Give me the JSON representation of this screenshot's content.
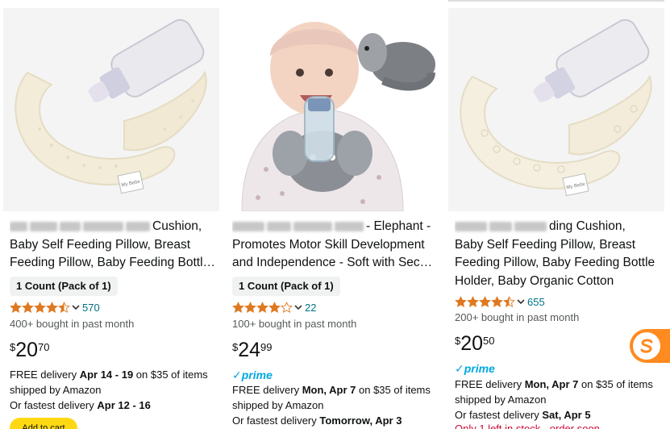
{
  "products": [
    {
      "title_line1_visible": "Cushion,",
      "title_line2": "Baby Self Feeding Pillow, Breast",
      "title_line3": "Feeding Pillow, Baby Feeding Bottl…",
      "title_line4": "",
      "pack": "1 Count (Pack of 1)",
      "rating_stars": 4.5,
      "rating_count": "570",
      "bought": "400+ bought in past month",
      "price_symbol": "$",
      "price_whole": "20",
      "price_fraction": "70",
      "prime": false,
      "delivery": {
        "prefix": "FREE delivery ",
        "date": "Apr 14 - 19",
        "suffix": " on $35 of items"
      },
      "shipped_by": "shipped by Amazon",
      "fastest": {
        "prefix": "Or fastest delivery ",
        "date": "Apr 12 - 16"
      },
      "add_to_cart": "Add to cart",
      "low_stock": ""
    },
    {
      "title_line1_visible": "- Elephant -",
      "title_line2": "Promotes Motor Skill Development",
      "title_line3": "and Independence - Soft with Sec…",
      "title_line4": "",
      "pack": "1 Count (Pack of 1)",
      "rating_stars": 4.0,
      "rating_count": "22",
      "bought": "100+ bought in past month",
      "price_symbol": "$",
      "price_whole": "24",
      "price_fraction": "99",
      "prime": true,
      "prime_label": "prime",
      "delivery": {
        "prefix": "FREE delivery ",
        "date": "Mon, Apr 7",
        "suffix": " on $35 of items"
      },
      "shipped_by": "shipped by Amazon",
      "fastest": {
        "prefix": "Or fastest delivery ",
        "date": "Tomorrow, Apr 3"
      },
      "add_to_cart": "",
      "low_stock": ""
    },
    {
      "title_line1_visible": "ding Cushion,",
      "title_line2": "Baby Self Feeding Pillow, Breast",
      "title_line3": "Feeding Pillow, Baby Feeding Bottle",
      "title_line4": "Holder, Baby Organic Cotton",
      "pack": "",
      "rating_stars": 4.5,
      "rating_count": "655",
      "bought": "200+ bought in past month",
      "price_symbol": "$",
      "price_whole": "20",
      "price_fraction": "50",
      "prime": true,
      "prime_label": "prime",
      "delivery": {
        "prefix": "FREE delivery ",
        "date": "Mon, Apr 7",
        "suffix": " on $35 of items"
      },
      "shipped_by": "shipped by Amazon",
      "fastest": {
        "prefix": "Or fastest delivery ",
        "date": "Sat, Apr 5"
      },
      "add_to_cart": "",
      "low_stock": "Only 1 left in stock - order soon."
    }
  ],
  "colors": {
    "star": "#de7921",
    "link": "#007185",
    "prime": "#00a8e1",
    "add_to_cart": "#ffd814",
    "fab": "#ff8a1f"
  },
  "icons": {
    "rating_dropdown": "chevron-down-icon",
    "prime_check": "checkmark-icon",
    "floating_widget": "extension-s-icon"
  }
}
